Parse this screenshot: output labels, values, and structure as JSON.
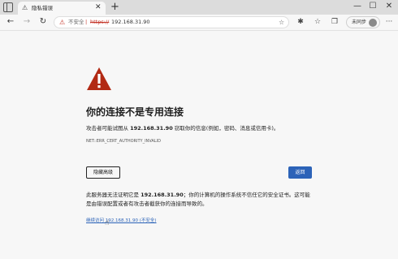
{
  "browser": {
    "tab": {
      "title": "隐私错误",
      "warning_icon": "⚠",
      "close": "✕"
    },
    "new_tab": "+",
    "window_controls": {
      "minimize": "—",
      "maximize": "☐",
      "close": "✕"
    }
  },
  "toolbar": {
    "back": "←",
    "forward": "→",
    "refresh": "↻",
    "address": {
      "warning_icon": "⚠",
      "security_label": "不安全",
      "separator": "|",
      "scheme": "https://",
      "host": "192.168.31.90"
    },
    "sync_button": {
      "label": "未同步"
    },
    "more": "···"
  },
  "page": {
    "heading": "你的连接不是专用连接",
    "description_prefix": "攻击者可能试图从 ",
    "host": "192.168.31.90",
    "description_suffix": " 窃取你的信息(例如，密码、消息或信用卡)。",
    "error_code": "NET::ERR_CERT_AUTHORITY_INVALID",
    "advanced_button": "隐藏高级",
    "back_button": "返回",
    "details_prefix": "此服务器无法证明它是 ",
    "details_host": "192.168.31.90",
    "details_suffix": "；你的计算机的操作系统不信任它的安全证书。这可能是由错误配置或者有攻击者截获你的连接而导致的。",
    "proceed_link": "继续访问 192.168.31.90 (不安全)"
  }
}
